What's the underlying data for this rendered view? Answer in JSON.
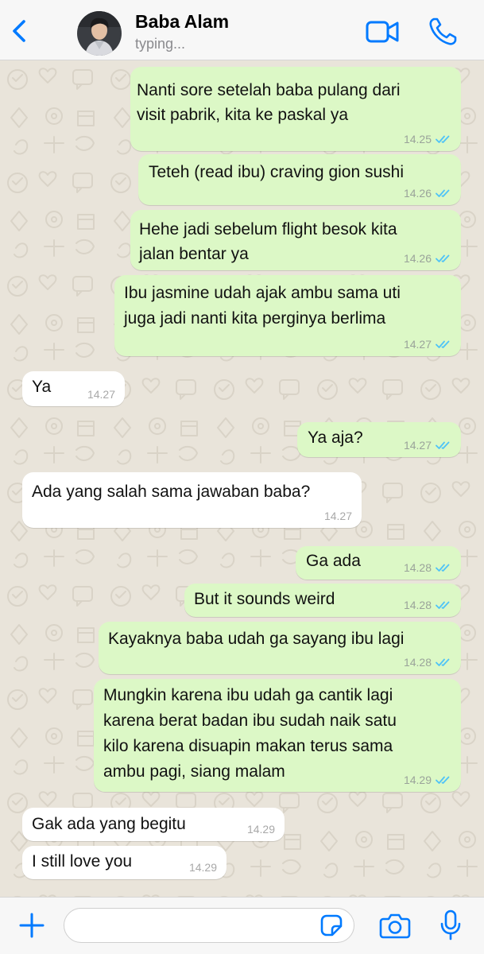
{
  "header": {
    "contact_name": "Baba Alam",
    "status": "typing...",
    "icons": [
      "chevron-left-icon",
      "avatar",
      "video-call-icon",
      "phone-icon"
    ]
  },
  "colors": {
    "accent": "#007aff",
    "outgoing_bubble": "#dcf8c6",
    "incoming_bubble": "#ffffff",
    "read_ticks": "#4fc3f7",
    "wallpaper": "#e9e4da"
  },
  "messages": [
    {
      "direction": "out",
      "lines": [
        "Nanti sore setelah baba pulang dari",
        "visit pabrik, kita ke paskal ya"
      ],
      "time": "14.25",
      "status": "read"
    },
    {
      "direction": "out",
      "lines": [
        "Teteh (read ibu) craving gion sushi"
      ],
      "time": "14.26",
      "status": "read"
    },
    {
      "direction": "out",
      "lines": [
        "Hehe jadi sebelum flight besok kita",
        "jalan bentar ya"
      ],
      "time": "14.26",
      "status": "read"
    },
    {
      "direction": "out",
      "lines": [
        "Ibu jasmine udah ajak ambu sama uti",
        "juga jadi nanti kita perginya berlima"
      ],
      "time": "14.27",
      "status": "read"
    },
    {
      "direction": "in",
      "lines": [
        "Ya"
      ],
      "time": "14.27"
    },
    {
      "direction": "out",
      "lines": [
        "Ya aja?"
      ],
      "time": "14.27",
      "status": "read"
    },
    {
      "direction": "in",
      "lines": [
        "Ada yang salah sama jawaban baba?"
      ],
      "time": "14.27"
    },
    {
      "direction": "out",
      "lines": [
        "Ga ada"
      ],
      "time": "14.28",
      "status": "read"
    },
    {
      "direction": "out",
      "lines": [
        "But it sounds weird"
      ],
      "time": "14.28",
      "status": "read"
    },
    {
      "direction": "out",
      "lines": [
        "Kayaknya baba udah ga sayang ibu lagi"
      ],
      "time": "14.28",
      "status": "read"
    },
    {
      "direction": "out",
      "lines": [
        "Mungkin karena ibu udah ga cantik lagi",
        "karena berat badan ibu sudah naik satu",
        "kilo karena disuapin makan terus sama",
        "ambu pagi, siang malam"
      ],
      "time": "14.29",
      "status": "read"
    },
    {
      "direction": "in",
      "lines": [
        "Gak ada yang begitu"
      ],
      "time": "14.29"
    },
    {
      "direction": "in",
      "lines": [
        "I still love you"
      ],
      "time": "14.29"
    }
  ],
  "composer": {
    "value": "",
    "placeholder": "",
    "icons": [
      "plus-icon",
      "sticker-icon",
      "camera-icon",
      "microphone-icon"
    ]
  }
}
